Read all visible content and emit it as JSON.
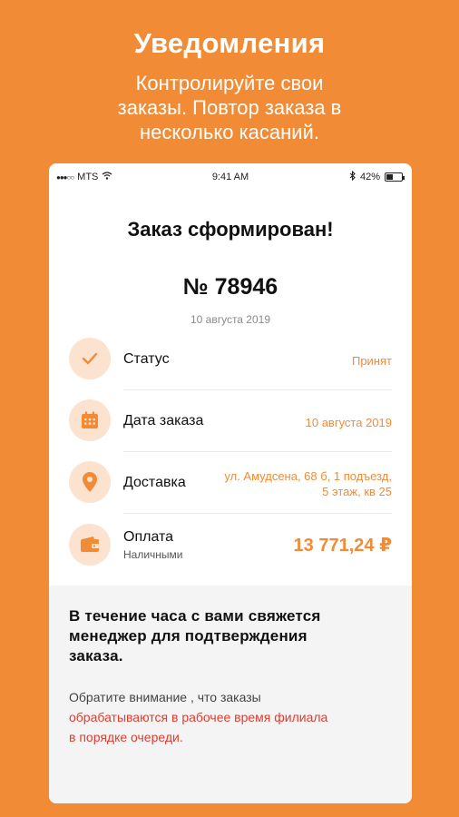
{
  "promo": {
    "title": "Уведомления",
    "subtitle_line1": "Контролируйте свои",
    "subtitle_line2": "заказы. Повтор заказа в",
    "subtitle_line3": "несколько касаний."
  },
  "status_bar": {
    "carrier": "MTS",
    "time": "9:41 AM",
    "battery": "42%",
    "battery_level": 0.42
  },
  "order": {
    "title": "Заказ сформирован!",
    "number": "№ 78946",
    "date": "10 августа 2019"
  },
  "rows": [
    {
      "label": "Статус",
      "value": "Принят",
      "icon": "check-icon"
    },
    {
      "label": "Дата заказа",
      "value": "10 августа 2019",
      "icon": "calendar-icon"
    },
    {
      "label": "Доставка",
      "value_line1": "ул. Амудсена, 68 б, 1 подъезд,",
      "value_line2": "5 этаж, кв 25",
      "icon": "location-pin-icon"
    },
    {
      "label": "Оплата",
      "sublabel": "Наличными",
      "value": "13 771,24 ₽",
      "icon": "wallet-icon"
    }
  ],
  "info": {
    "bold_line1": "В течение часа с вами свяжется",
    "bold_line2": "менеджер  для подтверждения",
    "bold_line3": "заказа.",
    "note_plain": "Обратите внимание , что заказы",
    "note_red_line1": "обрабатываются в рабочее время филиала",
    "note_red_line2": "в порядке очереди."
  },
  "colors": {
    "accent": "#F28B35",
    "accent_light": "#FCE3CF",
    "warning_text": "#E23B2E"
  }
}
